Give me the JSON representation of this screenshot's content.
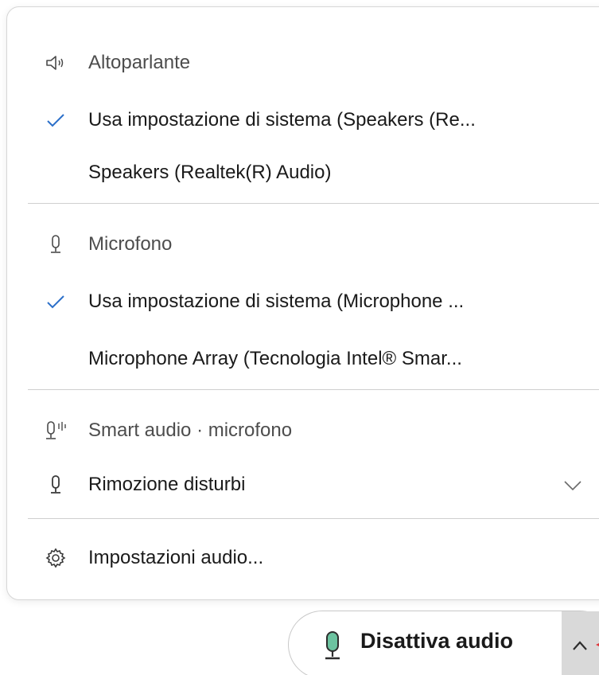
{
  "menu": {
    "speaker": {
      "header": "Altoparlante",
      "icon": "speaker-icon",
      "items": [
        {
          "label": "Usa impostazione di sistema (Speakers (Re...",
          "checked": true
        },
        {
          "label": "Speakers (Realtek(R) Audio)",
          "checked": false
        }
      ]
    },
    "microphone": {
      "header": "Microfono",
      "icon": "microphone-icon",
      "items": [
        {
          "label": "Usa impostazione di sistema (Microphone ...",
          "checked": true
        },
        {
          "label": "Microphone Array (Tecnologia Intel® Smar...",
          "checked": false
        }
      ]
    },
    "smart_audio": {
      "header": "Smart audio · microfono",
      "icon": "smart-audio-microphone-icon",
      "dropdown_value": "Rimozione disturbi",
      "dropdown_icon": "microphone-icon"
    },
    "settings": {
      "label": "Impostazioni audio...",
      "icon": "gear-icon"
    }
  },
  "audio_button": {
    "label": "Disattiva audio",
    "icon": "microphone-icon",
    "accent_color": "#6cc3a0"
  },
  "colors": {
    "check": "#2b6fc9",
    "accent_arrow": "#e0363a"
  }
}
